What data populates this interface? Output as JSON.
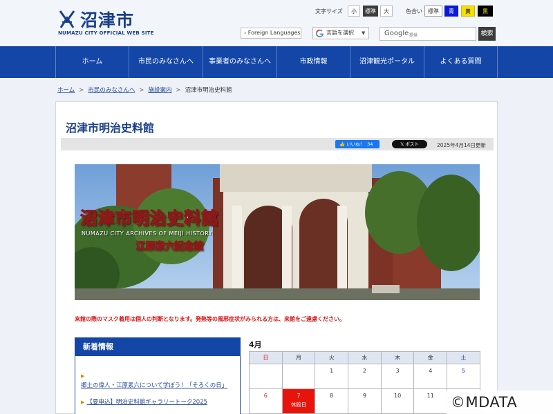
{
  "header": {
    "logo_text": "沼津市",
    "logo_sub": "NUMAZU CITY OFFICIAL WEB SITE",
    "font_size_label": "文字サイズ",
    "font_size_options": [
      "小",
      "標準",
      "大"
    ],
    "color_label": "色合い",
    "color_options": [
      "標準",
      "青",
      "黄",
      "黒"
    ],
    "foreign_languages": "Foreign Languages",
    "translate_label": "言語を選択",
    "search_placeholder_brand": "Google",
    "search_powered": "提供",
    "search_button": "検索"
  },
  "nav": {
    "items": [
      "ホーム",
      "市民のみなさんへ",
      "事業者のみなさんへ",
      "市政情報",
      "沼津観光ポータル",
      "よくある質問"
    ]
  },
  "breadcrumb": {
    "items": [
      "ホーム",
      "市民のみなさんへ",
      "施設案内"
    ],
    "current": "沼津市明治史料館"
  },
  "page": {
    "title": "沼津市明治史料館",
    "like_label": "いいね！",
    "like_count": "34",
    "post_label": "ポスト",
    "updated": "2025年4月14日更新"
  },
  "hero": {
    "title": "沼津市明治史料館",
    "subtitle": "NUMAZU CITY ARCHIVES OF MEIJI HISTORY",
    "memorial": "江原素六記念館"
  },
  "notice": "来館の際のマスク着用は個人の判断となります。発熱等の風邪症状がみられる方は、来館をご遠慮ください。",
  "news": {
    "heading": "新着情報",
    "items": [
      "郷土の偉人・江原素六について学ぼう！「そろくの日」",
      "【要申込】明治史料館ギャラリートーク2025"
    ]
  },
  "calendar": {
    "month": "4月",
    "weekdays": [
      "日",
      "月",
      "火",
      "水",
      "木",
      "金",
      "土"
    ],
    "week1": [
      "",
      "",
      "1",
      "2",
      "3",
      "4",
      "5"
    ],
    "week2": [
      "6",
      "7",
      "8",
      "9",
      "10",
      "11",
      ""
    ],
    "closed_label": "休館日"
  },
  "watermark": "©MDATA",
  "colors": {
    "brand_blue": "#1446a8",
    "notice_red": "#d61515",
    "closed_red": "#e8140c"
  }
}
